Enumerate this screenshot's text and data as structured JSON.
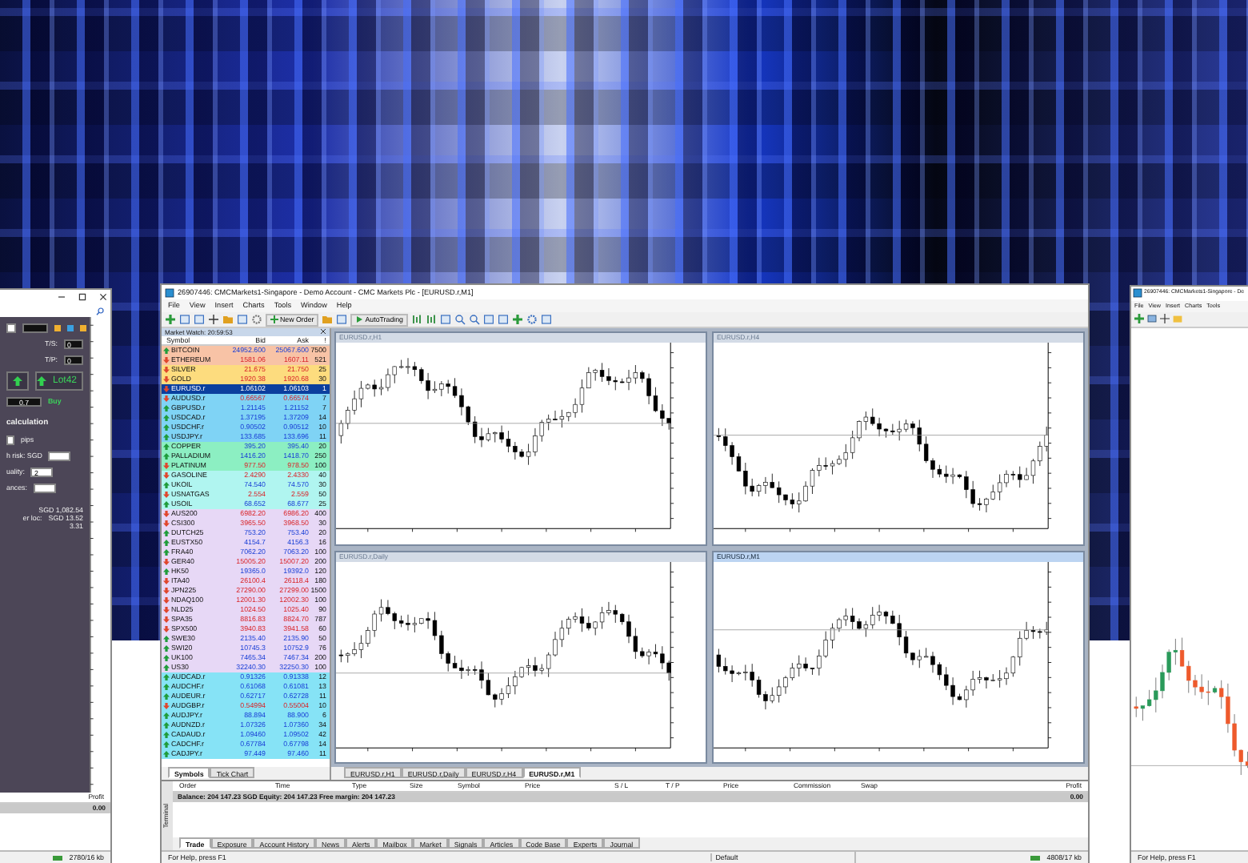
{
  "left_window": {
    "trade_panel": {
      "ts_label": "T/S:",
      "ts_value": "0",
      "tp_label": "T/P:",
      "tp_value": "0",
      "lot_value": "0.7",
      "big_label": "Lot42",
      "buy_label": "Buy"
    },
    "calc_title": "calculation",
    "calc_fields": [
      {
        "kind": "input_first",
        "label": "pips"
      },
      {
        "kind": "label_input",
        "label": "h risk:  SGD"
      },
      {
        "kind": "label_input",
        "label": "uality:",
        "value": "2"
      },
      {
        "kind": "label_input",
        "label": "ances:"
      }
    ],
    "calc_results": [
      {
        "value": "SGD 1,082.54"
      },
      {
        "label": "er loc:",
        "value": "SGD 13.52"
      },
      {
        "value": "3.31"
      }
    ],
    "terminal_column": "Profit",
    "terminal_value": "0.00",
    "status": "2780/16 kb"
  },
  "main_window": {
    "title": "26907446: CMCMarkets1-Singapore - Demo Account - CMC Markets Plc - [EURUSD.r,M1]",
    "menu": [
      "File",
      "View",
      "Insert",
      "Charts",
      "Tools",
      "Window",
      "Help"
    ],
    "toolbar_buttons": [
      {
        "label": "New Order"
      },
      {
        "label": "AutoTrading"
      }
    ],
    "market_watch": {
      "title": "Market Watch: 20:59:53",
      "columns": [
        "Symbol",
        "Bid",
        "Ask",
        "!"
      ],
      "groups": [
        {
          "color": "#f8c3a6",
          "rows": [
            {
              "symbol": "BITCOIN",
              "bid": "24952.600",
              "ask": "25067.600",
              "spread": "7500",
              "rising": true,
              "selected": false
            },
            {
              "symbol": "ETHEREUM",
              "bid": "1581.06",
              "ask": "1607.11",
              "spread": "521",
              "rising": false,
              "selected": false
            }
          ]
        },
        {
          "color": "#fddc7e",
          "rows": [
            {
              "symbol": "SILVER",
              "bid": "21.675",
              "ask": "21.750",
              "spread": "25",
              "rising": false,
              "selected": false
            },
            {
              "symbol": "GOLD",
              "bid": "1920.38",
              "ask": "1920.68",
              "spread": "30",
              "rising": false,
              "selected": false
            }
          ]
        },
        {
          "color": "#7fd3f5",
          "rows": [
            {
              "symbol": "EURUSD.r",
              "bid": "1.06102",
              "ask": "1.06103",
              "spread": "1",
              "rising": false,
              "selected": true
            },
            {
              "symbol": "AUDUSD.r",
              "bid": "0.66567",
              "ask": "0.66574",
              "spread": "7",
              "rising": false,
              "selected": false
            },
            {
              "symbol": "GBPUSD.r",
              "bid": "1.21145",
              "ask": "1.21152",
              "spread": "7",
              "rising": true,
              "selected": false
            },
            {
              "symbol": "USDCAD.r",
              "bid": "1.37195",
              "ask": "1.37209",
              "spread": "14",
              "rising": true,
              "selected": false
            },
            {
              "symbol": "USDCHF.r",
              "bid": "0.90502",
              "ask": "0.90512",
              "spread": "10",
              "rising": true,
              "selected": false
            },
            {
              "symbol": "USDJPY.r",
              "bid": "133.685",
              "ask": "133.696",
              "spread": "11",
              "rising": true,
              "selected": false
            }
          ]
        },
        {
          "color": "#8cefc2",
          "rows": [
            {
              "symbol": "COPPER",
              "bid": "395.20",
              "ask": "395.40",
              "spread": "20",
              "rising": true,
              "selected": false
            },
            {
              "symbol": "PALLADIUM",
              "bid": "1416.20",
              "ask": "1418.70",
              "spread": "250",
              "rising": true,
              "selected": false
            },
            {
              "symbol": "PLATINUM",
              "bid": "977.50",
              "ask": "978.50",
              "spread": "100",
              "rising": false,
              "selected": false
            }
          ]
        },
        {
          "color": "#b0f5f0",
          "rows": [
            {
              "symbol": "GASOLINE",
              "bid": "2.4290",
              "ask": "2.4330",
              "spread": "40",
              "rising": false,
              "selected": false
            },
            {
              "symbol": "UKOIL",
              "bid": "74.540",
              "ask": "74.570",
              "spread": "30",
              "rising": true,
              "selected": false
            },
            {
              "symbol": "USNATGAS",
              "bid": "2.554",
              "ask": "2.559",
              "spread": "50",
              "rising": false,
              "selected": false
            },
            {
              "symbol": "USOIL",
              "bid": "68.652",
              "ask": "68.677",
              "spread": "25",
              "rising": true,
              "selected": false
            }
          ]
        },
        {
          "color": "#e7d8f6",
          "rows": [
            {
              "symbol": "AUS200",
              "bid": "6982.20",
              "ask": "6986.20",
              "spread": "400",
              "rising": false,
              "selected": false
            },
            {
              "symbol": "CSI300",
              "bid": "3965.50",
              "ask": "3968.50",
              "spread": "30",
              "rising": false,
              "selected": false
            },
            {
              "symbol": "DUTCH25",
              "bid": "753.20",
              "ask": "753.40",
              "spread": "20",
              "rising": true,
              "selected": false
            },
            {
              "symbol": "EUSTX50",
              "bid": "4154.7",
              "ask": "4156.3",
              "spread": "16",
              "rising": true,
              "selected": false
            },
            {
              "symbol": "FRA40",
              "bid": "7062.20",
              "ask": "7063.20",
              "spread": "100",
              "rising": true,
              "selected": false
            },
            {
              "symbol": "GER40",
              "bid": "15005.20",
              "ask": "15007.20",
              "spread": "200",
              "rising": false,
              "selected": false
            },
            {
              "symbol": "HK50",
              "bid": "19365.0",
              "ask": "19392.0",
              "spread": "120",
              "rising": true,
              "selected": false
            },
            {
              "symbol": "ITA40",
              "bid": "26100.4",
              "ask": "26118.4",
              "spread": "180",
              "rising": false,
              "selected": false
            },
            {
              "symbol": "JPN225",
              "bid": "27290.00",
              "ask": "27299.00",
              "spread": "1500",
              "rising": false,
              "selected": false
            },
            {
              "symbol": "NDAQ100",
              "bid": "12001.30",
              "ask": "12002.30",
              "spread": "100",
              "rising": false,
              "selected": false
            },
            {
              "symbol": "NLD25",
              "bid": "1024.50",
              "ask": "1025.40",
              "spread": "90",
              "rising": false,
              "selected": false
            },
            {
              "symbol": "SPA35",
              "bid": "8816.83",
              "ask": "8824.70",
              "spread": "787",
              "rising": false,
              "selected": false
            },
            {
              "symbol": "SPX500",
              "bid": "3940.83",
              "ask": "3941.58",
              "spread": "60",
              "rising": false,
              "selected": false
            },
            {
              "symbol": "SWE30",
              "bid": "2135.40",
              "ask": "2135.90",
              "spread": "50",
              "rising": true,
              "selected": false
            },
            {
              "symbol": "SWI20",
              "bid": "10745.3",
              "ask": "10752.9",
              "spread": "76",
              "rising": true,
              "selected": false
            },
            {
              "symbol": "UK100",
              "bid": "7465.34",
              "ask": "7467.34",
              "spread": "200",
              "rising": true,
              "selected": false
            },
            {
              "symbol": "US30",
              "bid": "32240.30",
              "ask": "32250.30",
              "spread": "100",
              "rising": true,
              "selected": false
            }
          ]
        },
        {
          "color": "#86e3f6",
          "rows": [
            {
              "symbol": "AUDCAD.r",
              "bid": "0.91326",
              "ask": "0.91338",
              "spread": "12",
              "rising": true,
              "selected": false
            },
            {
              "symbol": "AUDCHF.r",
              "bid": "0.61068",
              "ask": "0.61081",
              "spread": "13",
              "rising": true,
              "selected": false
            },
            {
              "symbol": "AUDEUR.r",
              "bid": "0.62717",
              "ask": "0.62728",
              "spread": "11",
              "rising": true,
              "selected": false
            },
            {
              "symbol": "AUDGBP.r",
              "bid": "0.54994",
              "ask": "0.55004",
              "spread": "10",
              "rising": false,
              "selected": false
            },
            {
              "symbol": "AUDJPY.r",
              "bid": "88.894",
              "ask": "88.900",
              "spread": "6",
              "rising": true,
              "selected": false
            },
            {
              "symbol": "AUDNZD.r",
              "bid": "1.07326",
              "ask": "1.07360",
              "spread": "34",
              "rising": true,
              "selected": false
            },
            {
              "symbol": "CADAUD.r",
              "bid": "1.09460",
              "ask": "1.09502",
              "spread": "42",
              "rising": true,
              "selected": false
            },
            {
              "symbol": "CADCHF.r",
              "bid": "0.67784",
              "ask": "0.67798",
              "spread": "14",
              "rising": true,
              "selected": false
            },
            {
              "symbol": "CADJPY.r",
              "bid": "97.449",
              "ask": "97.460",
              "spread": "11",
              "rising": true,
              "selected": false
            }
          ]
        }
      ],
      "tabs": [
        {
          "label": "Symbols",
          "selected": true
        },
        {
          "label": "Tick Chart",
          "selected": false
        }
      ]
    },
    "chart_windows": [
      {
        "title": "EURUSD.r,H1",
        "active": false
      },
      {
        "title": "EURUSD.r,H4",
        "active": false
      },
      {
        "title": "EURUSD.r,Daily",
        "active": false
      },
      {
        "title": "EURUSD.r,M1",
        "active": true
      }
    ],
    "chart_tabs": [
      {
        "label": "EURUSD.r,H1",
        "selected": false
      },
      {
        "label": "EURUSD.r,Daily",
        "selected": false
      },
      {
        "label": "EURUSD.r,H4",
        "selected": false
      },
      {
        "label": "EURUSD.r,M1",
        "selected": true
      }
    ],
    "terminal": {
      "side_label": "Terminal",
      "columns": [
        "Order",
        "Time",
        "Type",
        "Size",
        "Symbol",
        "Price",
        "S / L",
        "T / P",
        "Price",
        "Commission",
        "Swap",
        "Profit"
      ],
      "balance": "Balance: 204 147.23 SGD  Equity: 204 147.23  Free margin: 204 147.23",
      "profit": "0.00",
      "tabs": [
        {
          "label": "Trade",
          "selected": true
        },
        {
          "label": "Exposure",
          "selected": false
        },
        {
          "label": "Account History",
          "selected": false
        },
        {
          "label": "News",
          "selected": false
        },
        {
          "label": "Alerts",
          "selected": false
        },
        {
          "label": "Mailbox",
          "selected": false
        },
        {
          "label": "Market",
          "selected": false
        },
        {
          "label": "Signals",
          "selected": false
        },
        {
          "label": "Articles",
          "selected": false
        },
        {
          "label": "Code Base",
          "selected": false
        },
        {
          "label": "Experts",
          "selected": false
        },
        {
          "label": "Journal",
          "selected": false
        }
      ]
    },
    "status_bar": {
      "help": "For Help, press F1",
      "profile": "Default",
      "traffic": "4808/17 kb"
    }
  },
  "right_window": {
    "title": "26907446: CMCMarkets1-Singapore - De",
    "menu": [
      "File",
      "View",
      "Insert",
      "Charts",
      "Tools"
    ],
    "status": "For Help, press F1"
  }
}
